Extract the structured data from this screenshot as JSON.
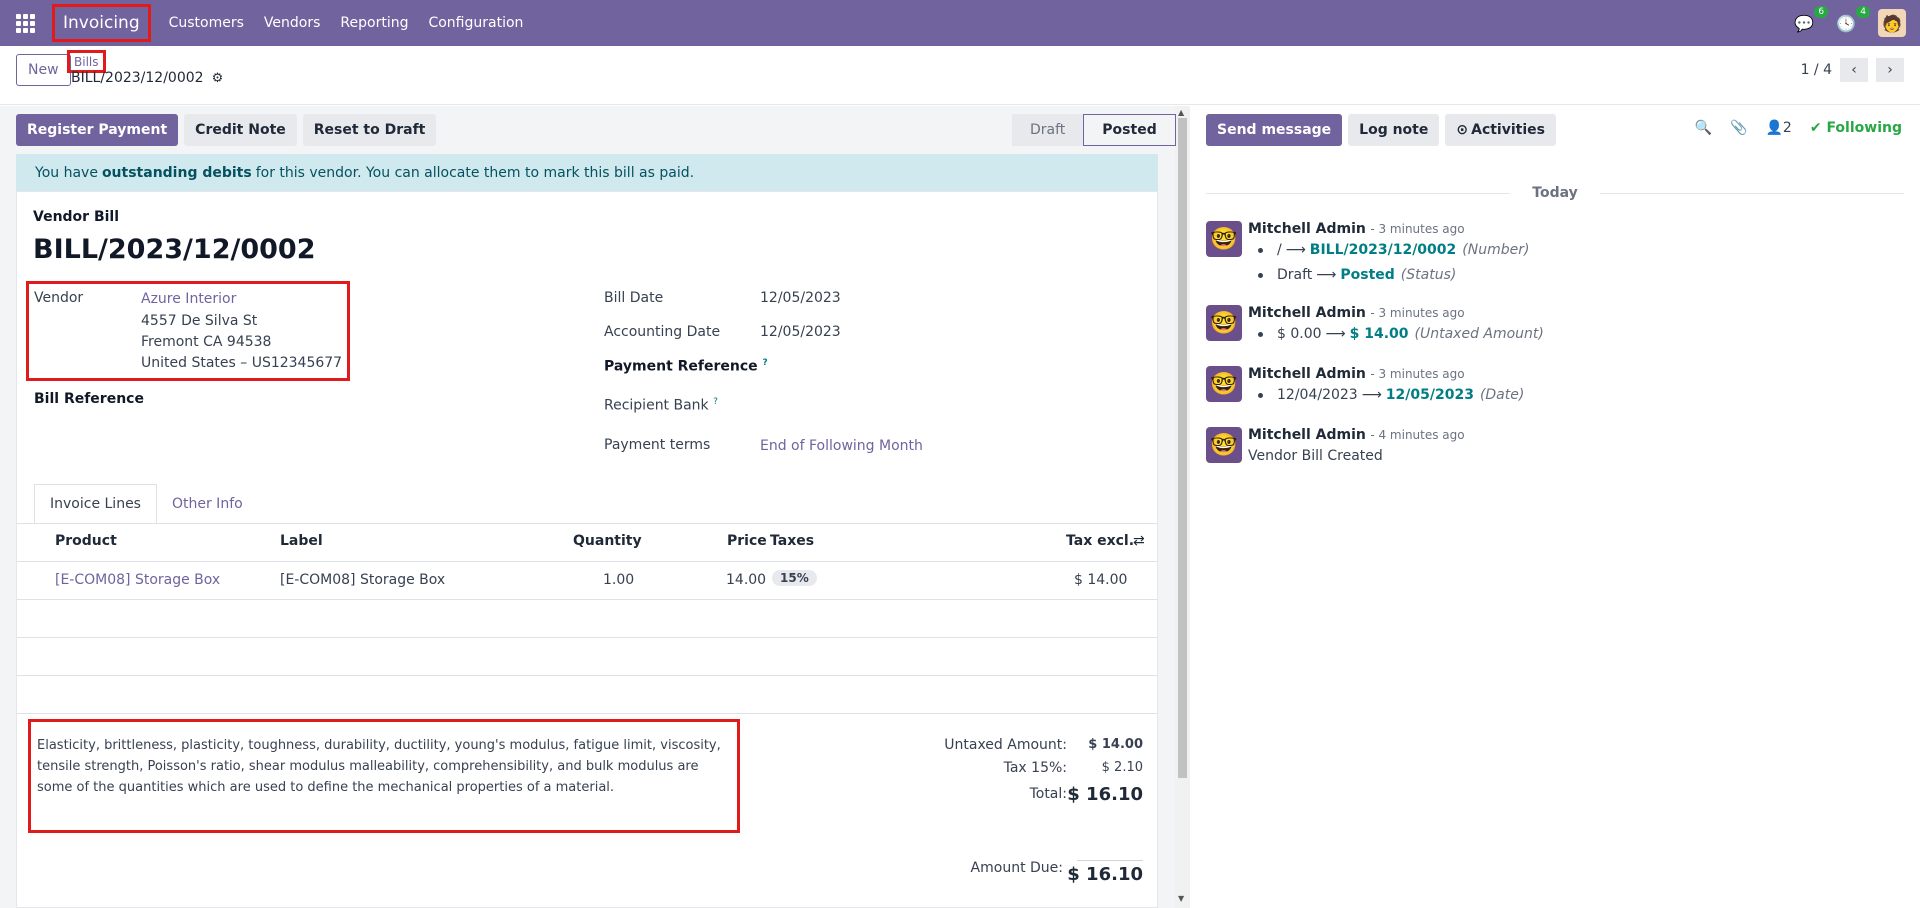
{
  "topbar": {
    "app_name": "Invoicing",
    "menu": [
      "Customers",
      "Vendors",
      "Reporting",
      "Configuration"
    ],
    "messages_count": "6",
    "activities_count": "4"
  },
  "control_panel": {
    "new_label": "New",
    "breadcrumb_parent": "Bills",
    "breadcrumb_current": "BILL/2023/12/0002",
    "pager": "1 / 4"
  },
  "actions": {
    "register_payment": "Register Payment",
    "credit_note": "Credit Note",
    "reset_to_draft": "Reset to Draft"
  },
  "stages": [
    "Draft",
    "Posted"
  ],
  "alert": {
    "prefix": "You have",
    "bold": "outstanding debits",
    "suffix": "for this vendor. You can allocate them to mark this bill as paid."
  },
  "bill": {
    "type_label": "Vendor Bill",
    "number": "BILL/2023/12/0002",
    "vendor_label": "Vendor",
    "vendor_name": "Azure Interior",
    "vendor_addr1": "4557 De Silva St",
    "vendor_addr2": "Fremont CA 94538",
    "vendor_addr3": "United States – US12345677",
    "bill_reference_label": "Bill Reference",
    "bill_date_label": "Bill Date",
    "bill_date": "12/05/2023",
    "accounting_date_label": "Accounting Date",
    "accounting_date": "12/05/2023",
    "payment_reference_label": "Payment Reference",
    "recipient_bank_label": "Recipient Bank",
    "payment_terms_label": "Payment terms",
    "payment_terms": "End of Following Month",
    "help_mark": "?"
  },
  "tabs": [
    "Invoice Lines",
    "Other Info"
  ],
  "lines": {
    "headers": {
      "product": "Product",
      "label": "Label",
      "quantity": "Quantity",
      "price": "Price",
      "taxes": "Taxes",
      "tax_excl": "Tax excl."
    },
    "rows": [
      {
        "product": "[E-COM08] Storage Box",
        "label": "[E-COM08] Storage Box",
        "quantity": "1.00",
        "price": "14.00",
        "tax": "15%",
        "subtotal": "$ 14.00"
      }
    ]
  },
  "notes": "Elasticity, brittleness, plasticity, toughness, durability, ductility, young's modulus, fatigue limit, viscosity, tensile strength, Poisson's ratio, shear modulus malleability, comprehensibility, and bulk modulus are some of the quantities which are used to define the mechanical properties of a material.",
  "totals": {
    "untaxed_label": "Untaxed Amount:",
    "untaxed": "$ 14.00",
    "tax_label": "Tax 15%:",
    "tax": "$ 2.10",
    "total_label": "Total:",
    "total": "$ 16.10",
    "amount_due_label": "Amount Due:",
    "amount_due": "$ 16.10"
  },
  "chatter": {
    "send_message": "Send message",
    "log_note": "Log note",
    "activities": "Activities",
    "followers_count": "2",
    "following": "Following",
    "today": "Today",
    "messages": [
      {
        "author": "Mitchell Admin",
        "time": "- 3 minutes ago",
        "changes": [
          {
            "old": "/",
            "new": "BILL/2023/12/0002",
            "field": "(Number)"
          },
          {
            "old": "Draft",
            "new": "Posted",
            "field": "(Status)"
          }
        ]
      },
      {
        "author": "Mitchell Admin",
        "time": "- 3 minutes ago",
        "changes": [
          {
            "old": "$ 0.00",
            "new": "$ 14.00",
            "field": "(Untaxed Amount)"
          }
        ]
      },
      {
        "author": "Mitchell Admin",
        "time": "- 3 minutes ago",
        "changes": [
          {
            "old": "12/04/2023",
            "new": "12/05/2023",
            "field": "(Date)"
          }
        ]
      },
      {
        "author": "Mitchell Admin",
        "time": "- 4 minutes ago",
        "body": "Vendor Bill Created"
      }
    ]
  },
  "colors": {
    "brand": "#71639e",
    "highlight": "#e01b1b",
    "success": "#28a745",
    "teal": "#017e84"
  }
}
